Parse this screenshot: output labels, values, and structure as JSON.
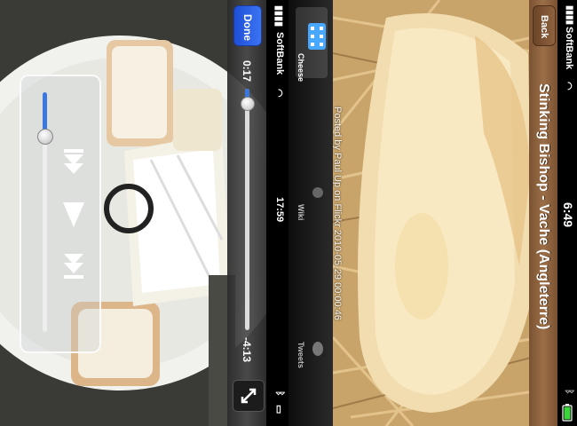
{
  "left": {
    "status": {
      "carrier": "SoftBank",
      "time": "17:59"
    },
    "toolbar": {
      "done_label": "Done",
      "elapsed": "0:17",
      "remaining": "-4:13",
      "progress": 0.06
    },
    "controls": {
      "volume": 0.18
    }
  },
  "right": {
    "status": {
      "carrier": "SoftBank",
      "time": "6:49"
    },
    "navbar": {
      "back_label": "Back",
      "title": "Stinking Bishop - Vache (Angleterre)"
    },
    "caption": "Posted by Paul Up on Flickr 2010-05-29 00:00:46",
    "tabs": [
      {
        "label": "Cheese",
        "icon": "list-icon",
        "active": true
      },
      {
        "label": "Wiki",
        "icon": "globe-icon",
        "active": false
      },
      {
        "label": "Tweets",
        "icon": "bird-icon",
        "active": false
      }
    ]
  },
  "colors": {
    "accent": "#3a78e0",
    "navbar": "#9b6e47"
  }
}
